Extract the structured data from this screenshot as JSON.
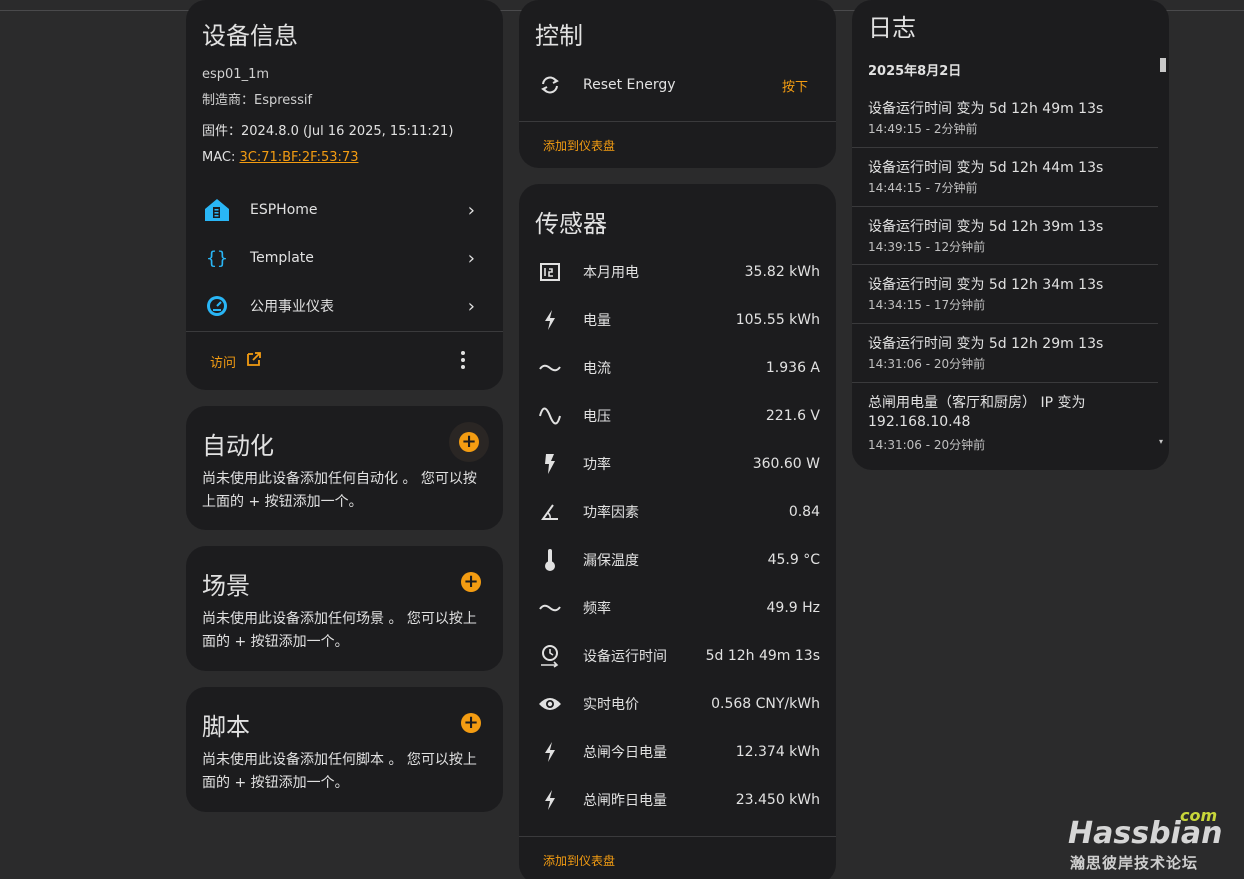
{
  "device_info": {
    "title": "设备信息",
    "name": "esp01_1m",
    "manufacturer": "制造商：Espressif",
    "firmware": "固件：2024.8.0 (Jul 16 2025, 15:11:21)",
    "mac_label": "MAC: ",
    "mac_value": "3C:71:BF:2F:53:73",
    "integrations": [
      {
        "label": "ESPHome",
        "icon": "esphome-icon"
      },
      {
        "label": "Template",
        "icon": "template-icon"
      },
      {
        "label": "公用事业仪表",
        "icon": "meter-icon"
      }
    ],
    "visit_label": "访问",
    "colors": {
      "accent": "#f39c12",
      "icon_blue": "#29b6f6"
    }
  },
  "automation": {
    "title": "自动化",
    "text_line1": "尚未使用此设备添加任何自动化 。 您可以按",
    "text_line2": "上面的 + 按钮添加一个。"
  },
  "scene": {
    "title": "场景",
    "text_line1": "尚未使用此设备添加任何场景 。 您可以按上",
    "text_line2": "面的 + 按钮添加一个。"
  },
  "script": {
    "title": "脚本",
    "text_line1": "尚未使用此设备添加任何脚本 。 您可以按上",
    "text_line2": "面的 + 按钮添加一个。"
  },
  "controls": {
    "title": "控制",
    "item_label": "Reset Energy",
    "item_action": "按下",
    "add_to_dashboard": "添加到仪表盘"
  },
  "sensors": {
    "title": "传感器",
    "items": [
      {
        "label": "本月用电",
        "value": "35.82 kWh",
        "icon": "counter-icon"
      },
      {
        "label": "电量",
        "value": "105.55 kWh",
        "icon": "flash-icon"
      },
      {
        "label": "电流",
        "value": "1.936 A",
        "icon": "current-ac-icon"
      },
      {
        "label": "电压",
        "value": "221.6 V",
        "icon": "sine-wave-icon"
      },
      {
        "label": "功率",
        "value": "360.60 W",
        "icon": "flash-bold-icon"
      },
      {
        "label": "功率因素",
        "value": "0.84",
        "icon": "angle-icon"
      },
      {
        "label": "漏保温度",
        "value": "45.9 °C",
        "icon": "thermometer-icon"
      },
      {
        "label": "频率",
        "value": "49.9 Hz",
        "icon": "current-ac-icon"
      },
      {
        "label": "设备运行时间",
        "value": "5d 12h 49m 13s",
        "icon": "timer-icon"
      },
      {
        "label": "实时电价",
        "value": "0.568 CNY/kWh",
        "icon": "eye-icon"
      },
      {
        "label": "总闸今日电量",
        "value": "12.374 kWh",
        "icon": "flash-icon"
      },
      {
        "label": "总闸昨日电量",
        "value": "23.450 kWh",
        "icon": "flash-icon"
      }
    ],
    "add_to_dashboard": "添加到仪表盘"
  },
  "logbook": {
    "title": "日志",
    "date": "2025年8月2日",
    "entries": [
      {
        "line1": "设备运行时间 变为 5d 12h 49m 13s",
        "line2": "14:49:15 - 2分钟前"
      },
      {
        "line1": "设备运行时间 变为 5d 12h 44m 13s",
        "line2": "14:44:15 - 7分钟前"
      },
      {
        "line1": "设备运行时间 变为 5d 12h 39m 13s",
        "line2": "14:39:15 - 12分钟前"
      },
      {
        "line1": "设备运行时间 变为 5d 12h 34m 13s",
        "line2": "14:34:15 - 17分钟前"
      },
      {
        "line1": "设备运行时间 变为 5d 12h 29m 13s",
        "line2": "14:31:06 - 20分钟前"
      },
      {
        "line1": "总闸用电量（客厅和厨房） IP 变为",
        "line1b": "192.168.10.48",
        "line2": "14:31:06 - 20分钟前"
      }
    ]
  },
  "watermark": {
    "com": "com",
    "brand": "Hassbian",
    "subtitle": "瀚思彼岸技术论坛"
  }
}
